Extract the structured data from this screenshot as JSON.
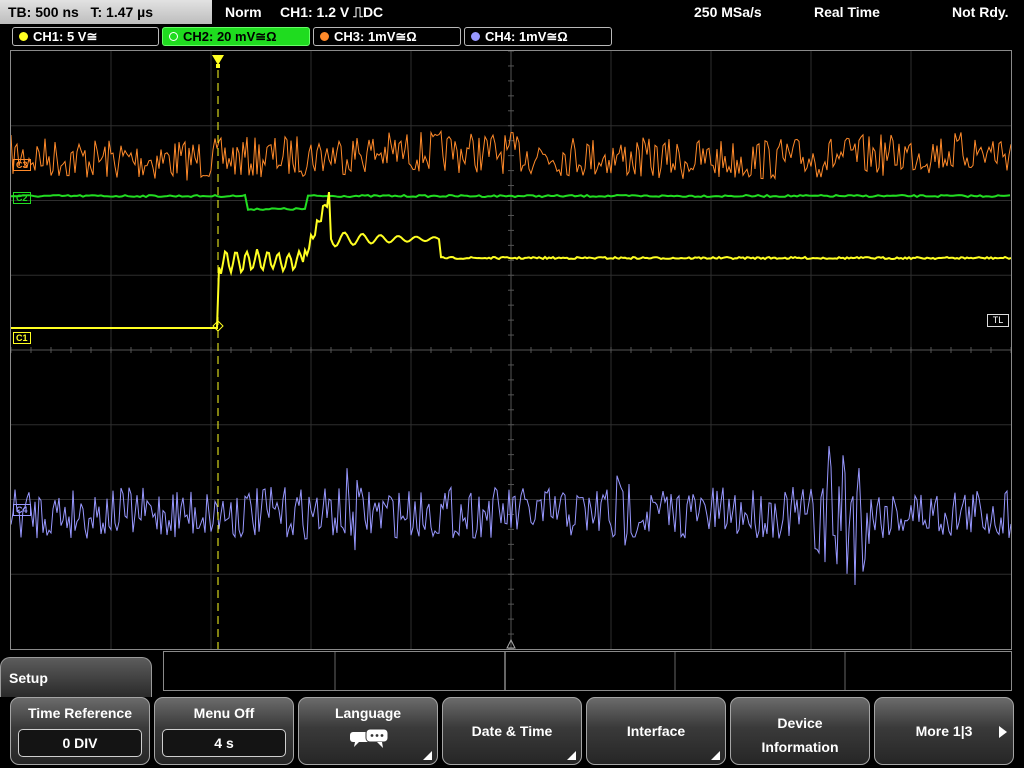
{
  "status": {
    "timebase": "TB: 500 ns",
    "trigger_time": "T: 1.47 µs",
    "mode": "Norm",
    "trigger_setting": "CH1: 1.2 V ⎍DC",
    "sample_rate": "250 MSa/s",
    "acquisition": "Real Time",
    "ready_state": "Not Rdy."
  },
  "channels": [
    {
      "label": "CH1: 5 V≅",
      "color": "#ffff22",
      "tag": "C1"
    },
    {
      "label": "CH2: 20 mV≅Ω",
      "color": "#22dd22",
      "tag": "C2"
    },
    {
      "label": "CH3: 1mV≅Ω",
      "color": "#ff8a2a",
      "tag": "C3"
    },
    {
      "label": "CH4: 1mV≅Ω",
      "color": "#9898ff",
      "tag": "C4"
    }
  ],
  "markers": {
    "trigger_level": "TL",
    "trigger_point": "T"
  },
  "menu": {
    "title": "Setup",
    "time_reference": {
      "title": "Time Reference",
      "value": "0 DIV"
    },
    "menu_off": {
      "title": "Menu Off",
      "value": "4 s"
    },
    "language": {
      "title": "Language",
      "icon": "speech-bubbles-icon"
    },
    "date_time": {
      "title": "Date & Time"
    },
    "interface": {
      "title": "Interface"
    },
    "device_information": {
      "line1": "Device",
      "line2": "Information"
    },
    "more": {
      "title": "More 1|3"
    }
  }
}
